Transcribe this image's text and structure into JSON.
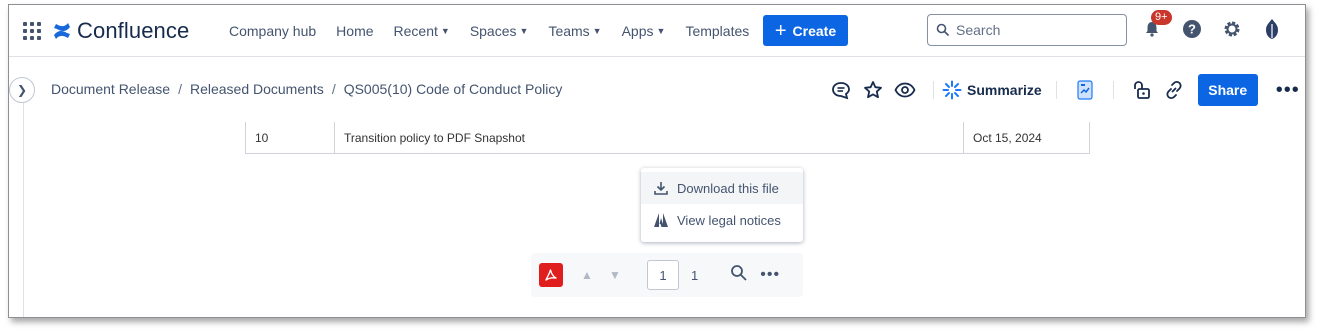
{
  "topnav": {
    "app_name": "Confluence",
    "links": [
      {
        "label": "Company hub",
        "has_menu": false
      },
      {
        "label": "Home",
        "has_menu": false
      },
      {
        "label": "Recent",
        "has_menu": true
      },
      {
        "label": "Spaces",
        "has_menu": true
      },
      {
        "label": "Teams",
        "has_menu": true
      },
      {
        "label": "Apps",
        "has_menu": true
      },
      {
        "label": "Templates",
        "has_menu": false
      }
    ],
    "create_label": "Create",
    "search_placeholder": "Search",
    "notification_badge": "9+",
    "accent": "#0c66e4"
  },
  "breadcrumb": {
    "items": [
      "Document Release",
      "Released Documents",
      "QS005(10) Code of Conduct Policy"
    ],
    "separator": "/"
  },
  "pagebar": {
    "summarize_label": "Summarize",
    "share_label": "Share",
    "icons": [
      "comment-icon",
      "star-icon",
      "watch-icon",
      "summarize-icon",
      "app-icon",
      "restrictions-icon",
      "link-icon",
      "more-icon"
    ]
  },
  "table_row": {
    "version": "10",
    "description": "Transition policy to PDF Snapshot",
    "date": "Oct 15, 2024"
  },
  "popup_menu": {
    "items": [
      {
        "label": "Download this file",
        "icon": "download-icon"
      },
      {
        "label": "View legal notices",
        "icon": "adobe-icon"
      }
    ]
  },
  "pdf_toolbar": {
    "current_page": "1",
    "total_pages": "1",
    "pdf_color": "#e01e1e"
  }
}
